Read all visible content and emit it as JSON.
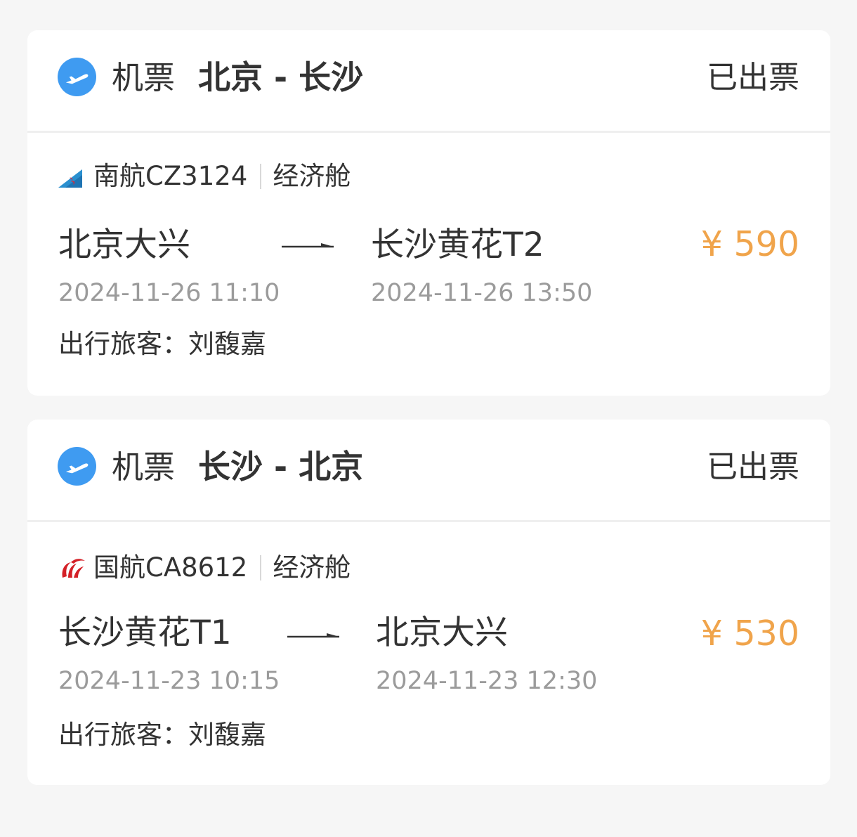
{
  "colors": {
    "background": "#f6f6f6",
    "card": "#ffffff",
    "text_primary": "#333333",
    "text_secondary": "#9b9b9b",
    "price": "#f0a44b",
    "plane_icon_bg": "#3f9bf1"
  },
  "tickets": [
    {
      "type_label": "机票",
      "route_title": "北京 - 长沙",
      "status": "已出票",
      "airline_icon": "china-southern-logo-icon",
      "flight": "南航CZ3124",
      "cabin": "经济舱",
      "departure_place": "北京大兴",
      "departure_time": "2024-11-26 11:10",
      "arrival_place": "长沙黄花T2",
      "arrival_time": "2024-11-26 13:50",
      "price": "¥ 590",
      "passenger": "出行旅客：刘馥嘉"
    },
    {
      "type_label": "机票",
      "route_title": "长沙 - 北京",
      "status": "已出票",
      "airline_icon": "air-china-logo-icon",
      "flight": "国航CA8612",
      "cabin": "经济舱",
      "departure_place": "长沙黄花T1",
      "departure_time": "2024-11-23 10:15",
      "arrival_place": "北京大兴",
      "arrival_time": "2024-11-23 12:30",
      "price": "¥ 530",
      "passenger": "出行旅客：刘馥嘉"
    }
  ]
}
